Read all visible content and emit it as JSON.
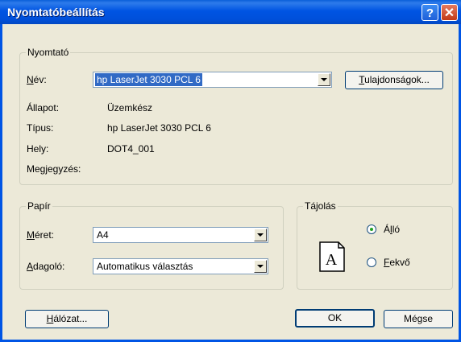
{
  "window": {
    "title": "Nyomtatóbeállítás",
    "help_glyph": "?",
    "close_glyph": "✕"
  },
  "printer": {
    "group_label": "Nyomtató",
    "name_label_u": "N",
    "name_label_rest": "év:",
    "name_value": "hp LaserJet 3030 PCL 6",
    "properties_u": "T",
    "properties_rest": "ulajdonságok...",
    "status_label": "Állapot:",
    "status_value": "Üzemkész",
    "type_label": "Típus:",
    "type_value": "hp LaserJet 3030 PCL 6",
    "where_label": "Hely:",
    "where_value": "DOT4_001",
    "comment_label": "Megjegyzés:"
  },
  "paper": {
    "group_label": "Papír",
    "size_label_u": "M",
    "size_label_rest": "éret:",
    "size_value": "A4",
    "source_label_u": "A",
    "source_label_rest": "dagoló:",
    "source_value": "Automatikus választás"
  },
  "orientation": {
    "group_label": "Tájolás",
    "portrait_pre": "Á",
    "portrait_u": "l",
    "portrait_rest": "ló",
    "landscape_u": "F",
    "landscape_rest": "ekvő",
    "selected": "portrait",
    "icon_letter": "A"
  },
  "buttons": {
    "network_u": "H",
    "network_rest": "álózat...",
    "ok": "OK",
    "cancel": "Mégse"
  }
}
